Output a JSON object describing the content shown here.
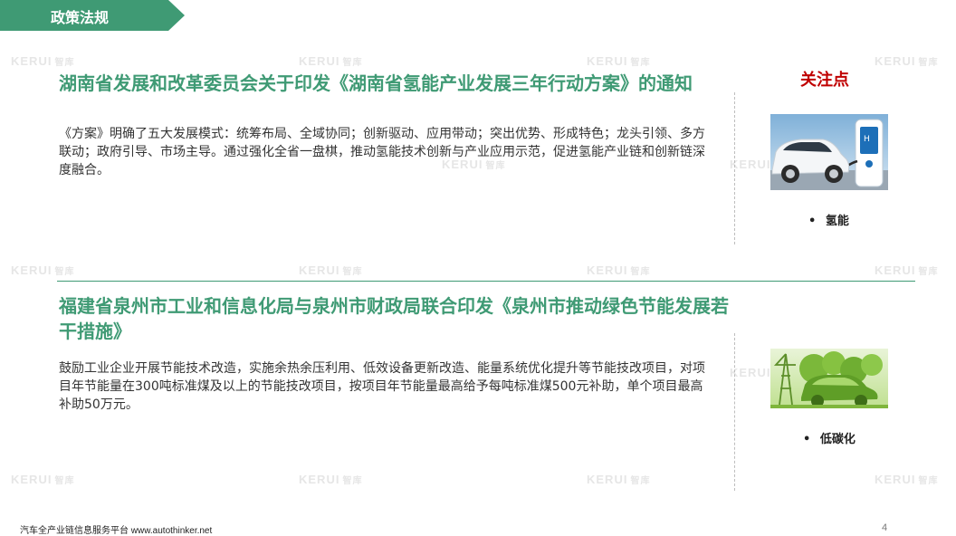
{
  "section": {
    "title": "政策法规"
  },
  "watermark": {
    "brand": "KERUI",
    "suffix": "智库"
  },
  "items": [
    {
      "title": "湖南省发展和改革委员会关于印发《湖南省氢能产业发展三年行动方案》的通知",
      "body": "《方案》明确了五大发展模式：统筹布局、全域协同；创新驱动、应用带动；突出优势、形成特色；龙头引领、多方联动；政府引导、市场主导。通过强化全省一盘棋，推动氢能技术创新与产业应用示范，促进氢能产业链和创新链深度融合。",
      "image": "hydrogen-car-charging-image",
      "tag": "氢能"
    },
    {
      "title": "福建省泉州市工业和信息化局与泉州市财政局联合印发《泉州市推动绿色节能发展若干措施》",
      "body": "鼓励工业企业开展节能技术改造，实施余热余压利用、低效设备更新改造、能量系统优化提升等节能技改项目，对项目年节能量在300吨标准煤及以上的节能技改项目，按项目年节能量最高给予每吨标准煤500元补助，单个项目最高补助50万元。",
      "image": "green-car-low-carbon-image",
      "tag": "低碳化"
    }
  ],
  "focus": {
    "label": "关注点"
  },
  "bullet": "•",
  "footer": {
    "text": "汽车全产业链信息服务平台 www.autothinker.net",
    "page": "4"
  },
  "colors": {
    "accent": "#3f9a74",
    "focus": "#c00000"
  }
}
